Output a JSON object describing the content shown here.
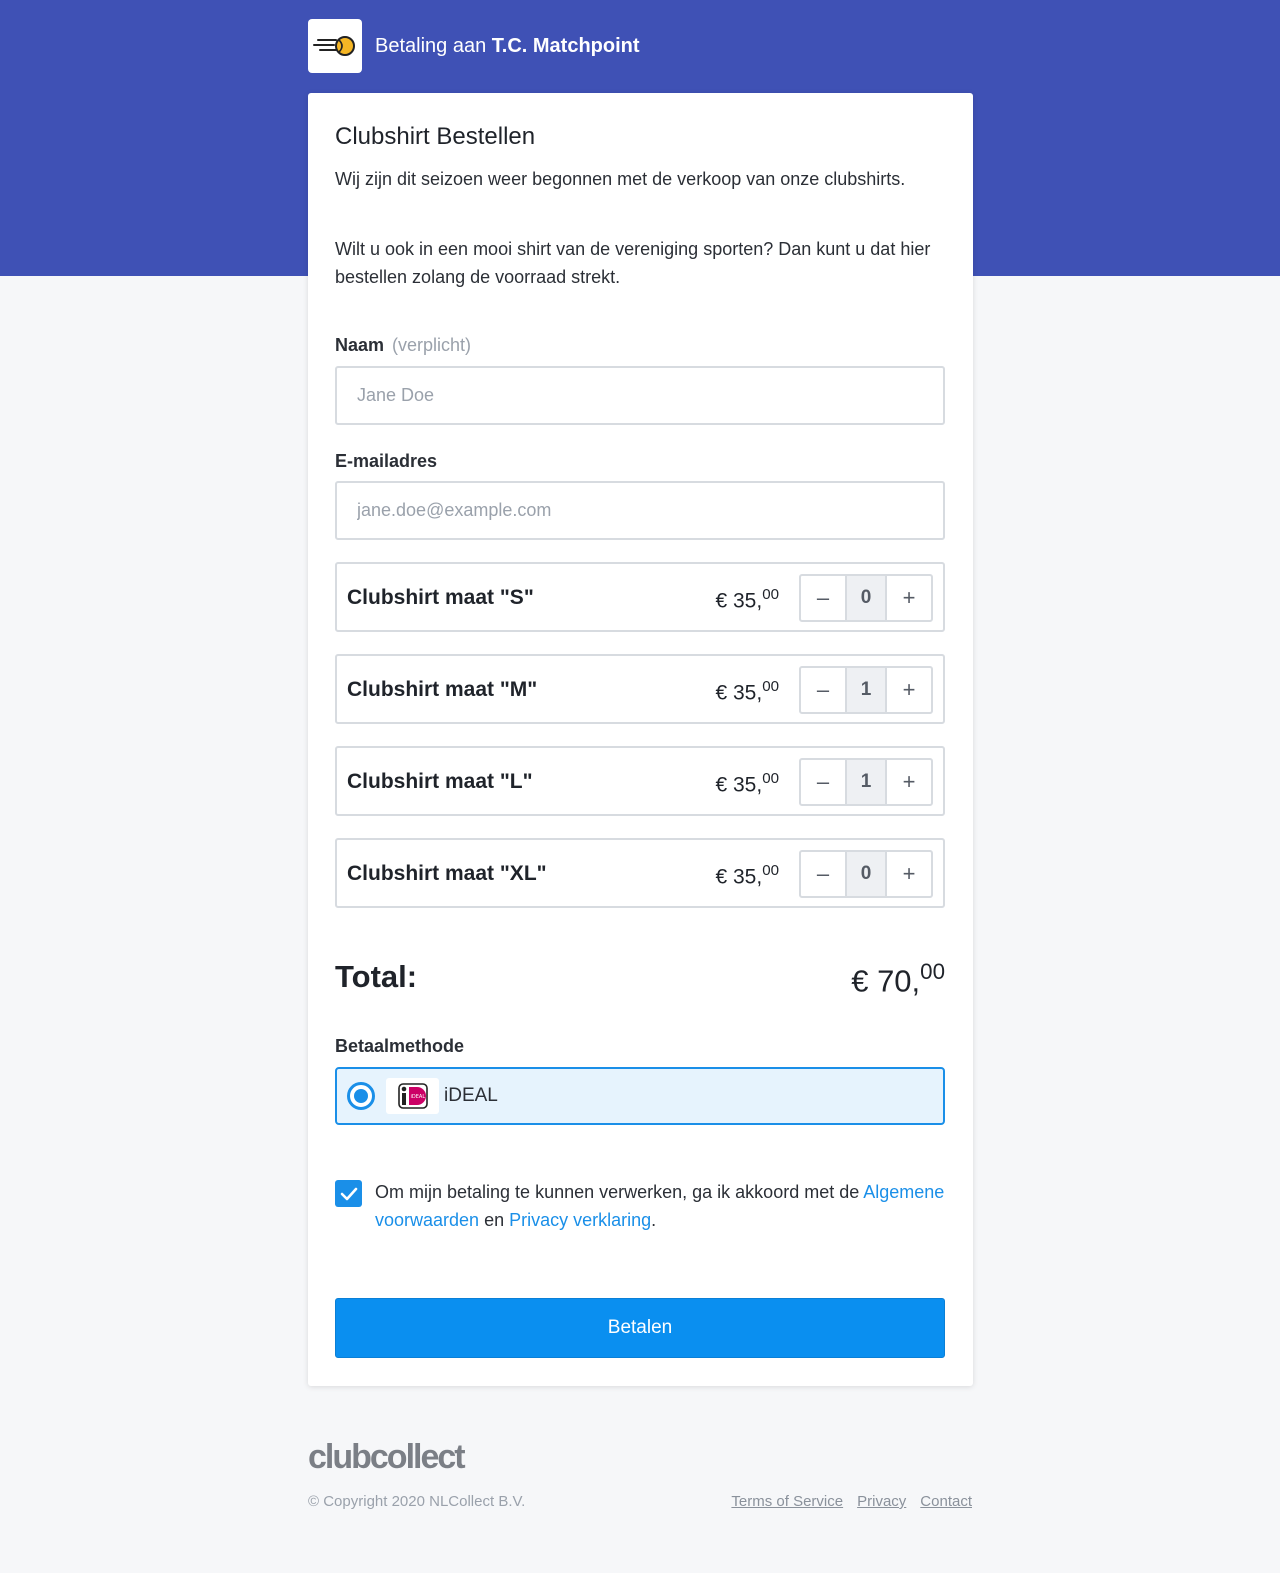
{
  "header": {
    "prefix": "Betaling aan",
    "club_name": "T.C. Matchpoint",
    "logo_icon": "tennis-ball-speed-icon",
    "bg_color": "#3f51b5"
  },
  "form": {
    "title": "Clubshirt Bestellen",
    "description_1": "Wij zijn dit seizoen weer begonnen met de verkoop van onze clubshirts.",
    "description_2": "Wilt u ook in een mooi shirt van de vereniging sporten? Dan kunt u dat hier bestellen zolang de voorraad strekt.",
    "name_label": "Naam",
    "name_required": "(verplicht)",
    "name_placeholder": "Jane Doe",
    "name_value": "",
    "email_label": "E-mailadres",
    "email_placeholder": "jane.doe@example.com",
    "email_value": ""
  },
  "products": [
    {
      "name": "Clubshirt maat \"S\"",
      "currency": "€",
      "price_whole": "35,",
      "price_cents": "00",
      "quantity": "0"
    },
    {
      "name": "Clubshirt maat \"M\"",
      "currency": "€",
      "price_whole": "35,",
      "price_cents": "00",
      "quantity": "1"
    },
    {
      "name": "Clubshirt maat \"L\"",
      "currency": "€",
      "price_whole": "35,",
      "price_cents": "00",
      "quantity": "1"
    },
    {
      "name": "Clubshirt maat \"XL\"",
      "currency": "€",
      "price_whole": "35,",
      "price_cents": "00",
      "quantity": "0"
    }
  ],
  "stepper": {
    "minus": "–",
    "plus": "+"
  },
  "total": {
    "label": "Total:",
    "currency": "€",
    "whole": "70,",
    "cents": "00"
  },
  "payment": {
    "label": "Betaalmethode",
    "method": "iDEAL",
    "method_icon": "ideal-logo-icon",
    "selected": true,
    "accent_color": "#1a8fe8"
  },
  "consent": {
    "checked": true,
    "text_before": "Om mijn betaling te kunnen verwerken, ga ik akkoord met de",
    "link_terms": "Algemene voorwaarden",
    "text_mid": "en",
    "link_privacy": "Privacy verklaring",
    "text_end": "."
  },
  "submit": {
    "label": "Betalen",
    "color": "#0a8ff0"
  },
  "footer": {
    "brand": "clubcollect",
    "copyright": "© Copyright 2020 NLCollect B.V.",
    "links": [
      "Terms of Service",
      "Privacy",
      "Contact"
    ]
  }
}
